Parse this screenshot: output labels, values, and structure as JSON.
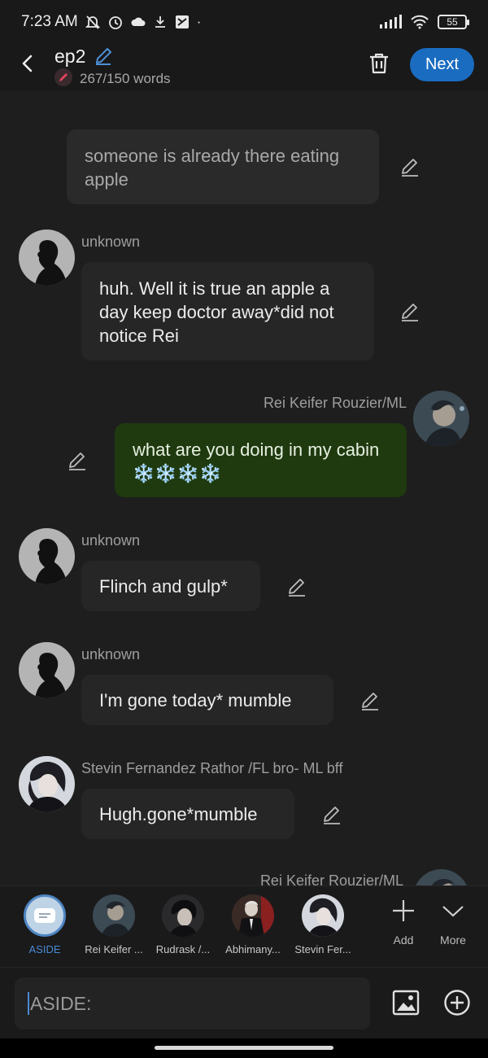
{
  "status": {
    "time": "7:23 AM",
    "battery": "55"
  },
  "header": {
    "title": "ep2",
    "word_count": "267/150 words",
    "next_label": "Next"
  },
  "messages": [
    {
      "type": "narration",
      "text": "someone is already there eating apple"
    },
    {
      "type": "character",
      "name": "unknown",
      "text": "huh. Well it is true  an apple a day keep doctor away*did not notice Rei"
    },
    {
      "type": "user",
      "name": "Rei Keifer Rouzier/ML",
      "text": "what are you doing in my cabin ❄️❄️❄️❄️"
    },
    {
      "type": "character",
      "name": "unknown",
      "text": "Flinch and gulp*"
    },
    {
      "type": "character",
      "name": "unknown",
      "text": "I'm gone today* mumble"
    },
    {
      "type": "character",
      "name": "Stevin Fernandez Rathor /FL bro- ML bff",
      "text": "Hugh.gone*mumble"
    },
    {
      "type": "user",
      "name": "Rei Keifer Rouzier/ML",
      "text": ""
    }
  ],
  "characters": [
    {
      "label": "ASIDE"
    },
    {
      "label": "Rei Keifer ..."
    },
    {
      "label": "Rudrask /..."
    },
    {
      "label": "Abhimany..."
    },
    {
      "label": "Stevin Fer..."
    }
  ],
  "tools": {
    "add_label": "Add",
    "more_label": "More"
  },
  "input": {
    "placeholder": "ASIDE:"
  },
  "colors": {
    "accent": "#1a6cc0",
    "user_bubble": "#1f3a0f",
    "aside": "#4a8ad4"
  }
}
